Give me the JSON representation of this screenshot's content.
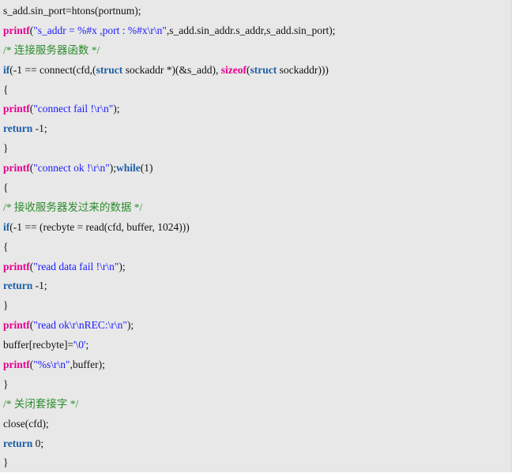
{
  "colors": {
    "background": "#e8e8e8",
    "function": "#e5008f",
    "keyword": "#1c5fa8",
    "string": "#1a1aff",
    "comment": "#2e8b2e",
    "text": "#111111"
  },
  "code_lines": [
    [
      {
        "t": "plain",
        "v": "s_add.sin_port=htons(portnum);"
      }
    ],
    [
      {
        "t": "fn",
        "v": "printf"
      },
      {
        "t": "plain",
        "v": "("
      },
      {
        "t": "str",
        "v": "\"s_addr = %#x ,port : %#x\\r\\n\""
      },
      {
        "t": "plain",
        "v": ",s_add.sin_addr.s_addr,s_add.sin_port);"
      }
    ],
    [
      {
        "t": "cmt",
        "v": "/* 连接服务器函数 */"
      }
    ],
    [
      {
        "t": "kw",
        "v": "if"
      },
      {
        "t": "plain",
        "v": "(-1 == connect(cfd,("
      },
      {
        "t": "kw",
        "v": "struct"
      },
      {
        "t": "plain",
        "v": " sockaddr *)(&s_add), "
      },
      {
        "t": "fn",
        "v": "sizeof"
      },
      {
        "t": "plain",
        "v": "("
      },
      {
        "t": "kw",
        "v": "struct"
      },
      {
        "t": "plain",
        "v": " sockaddr)))"
      }
    ],
    [
      {
        "t": "plain",
        "v": "{"
      }
    ],
    [
      {
        "t": "fn",
        "v": "printf"
      },
      {
        "t": "plain",
        "v": "("
      },
      {
        "t": "str",
        "v": "\"connect fail !\\r\\n\""
      },
      {
        "t": "plain",
        "v": ");"
      }
    ],
    [
      {
        "t": "kw",
        "v": "return"
      },
      {
        "t": "plain",
        "v": " -1;"
      }
    ],
    [
      {
        "t": "plain",
        "v": "}"
      }
    ],
    [
      {
        "t": "fn",
        "v": "printf"
      },
      {
        "t": "plain",
        "v": "("
      },
      {
        "t": "str",
        "v": "\"connect ok !\\r\\n\""
      },
      {
        "t": "plain",
        "v": ");"
      },
      {
        "t": "kw",
        "v": "while"
      },
      {
        "t": "plain",
        "v": "(1)"
      }
    ],
    [
      {
        "t": "plain",
        "v": "{"
      }
    ],
    [
      {
        "t": "cmt",
        "v": "/* 接收服务器发过来的数据 */"
      }
    ],
    [
      {
        "t": "kw",
        "v": "if"
      },
      {
        "t": "plain",
        "v": "(-1 == (recbyte = read(cfd, buffer, 1024)))"
      }
    ],
    [
      {
        "t": "plain",
        "v": "{"
      }
    ],
    [
      {
        "t": "fn",
        "v": "printf"
      },
      {
        "t": "plain",
        "v": "("
      },
      {
        "t": "str",
        "v": "\"read data fail !\\r\\n\""
      },
      {
        "t": "plain",
        "v": ");"
      }
    ],
    [
      {
        "t": "kw",
        "v": "return"
      },
      {
        "t": "plain",
        "v": " -1;"
      }
    ],
    [
      {
        "t": "plain",
        "v": "}"
      }
    ],
    [
      {
        "t": "fn",
        "v": "printf"
      },
      {
        "t": "plain",
        "v": "("
      },
      {
        "t": "str",
        "v": "\"read ok\\r\\nREC:\\r\\n\""
      },
      {
        "t": "plain",
        "v": ");"
      }
    ],
    [
      {
        "t": "plain",
        "v": "buffer[recbyte]="
      },
      {
        "t": "str",
        "v": "'\\0'"
      },
      {
        "t": "plain",
        "v": ";"
      }
    ],
    [
      {
        "t": "fn",
        "v": "printf"
      },
      {
        "t": "plain",
        "v": "("
      },
      {
        "t": "str",
        "v": "\"%s\\r\\n\""
      },
      {
        "t": "plain",
        "v": ",buffer);"
      }
    ],
    [
      {
        "t": "plain",
        "v": "}"
      }
    ],
    [
      {
        "t": "cmt",
        "v": "/* 关闭套接字 */"
      }
    ],
    [
      {
        "t": "plain",
        "v": "close(cfd);"
      }
    ],
    [
      {
        "t": "kw",
        "v": "return"
      },
      {
        "t": "plain",
        "v": " 0;"
      }
    ],
    [
      {
        "t": "plain",
        "v": "}"
      }
    ]
  ]
}
